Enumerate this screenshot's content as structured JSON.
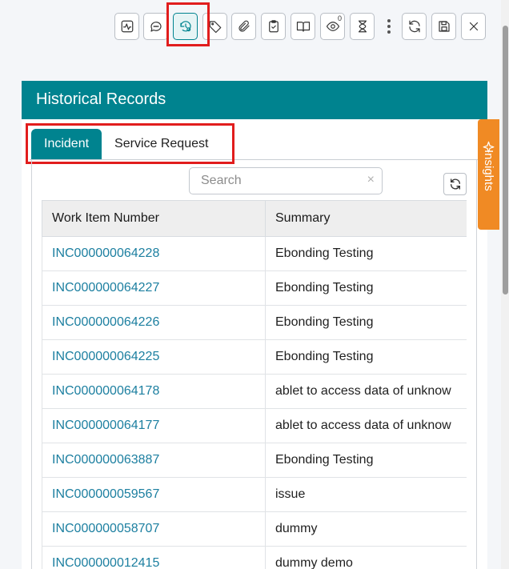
{
  "toolbar": {
    "buttons": [
      {
        "name": "activity-icon",
        "active": false
      },
      {
        "name": "chat-icon",
        "active": false
      },
      {
        "name": "history-settings-icon",
        "active": true
      },
      {
        "name": "tag-icon",
        "active": false
      },
      {
        "name": "paperclip-icon",
        "active": false
      },
      {
        "name": "clipboard-check-icon",
        "active": false
      },
      {
        "name": "book-open-icon",
        "active": false
      },
      {
        "name": "eye-icon",
        "active": false,
        "badge": "0"
      },
      {
        "name": "hourglass-icon",
        "active": false
      },
      {
        "name": "kebab-menu-icon",
        "active": false
      },
      {
        "name": "refresh-icon",
        "active": false
      },
      {
        "name": "save-icon",
        "active": false
      },
      {
        "name": "close-icon",
        "active": false
      }
    ]
  },
  "panel": {
    "title": "Historical Records"
  },
  "tabs": [
    {
      "label": "Incident",
      "active": true
    },
    {
      "label": "Service Request",
      "active": false
    }
  ],
  "search": {
    "placeholder": "Search",
    "value": "",
    "clear_icon": "×"
  },
  "table": {
    "columns": [
      "Work Item Number",
      "Summary"
    ],
    "rows": [
      {
        "number": "INC000000064228",
        "summary": "Ebonding Testing"
      },
      {
        "number": "INC000000064227",
        "summary": "Ebonding Testing"
      },
      {
        "number": "INC000000064226",
        "summary": "Ebonding Testing"
      },
      {
        "number": "INC000000064225",
        "summary": "Ebonding Testing"
      },
      {
        "number": "INC000000064178",
        "summary": "ablet to access data of unknow"
      },
      {
        "number": "INC000000064177",
        "summary": "ablet to access data of unknow"
      },
      {
        "number": "INC000000063887",
        "summary": "Ebonding Testing"
      },
      {
        "number": "INC000000059567",
        "summary": "issue"
      },
      {
        "number": "INC000000058707",
        "summary": "dummy"
      },
      {
        "number": "INC000000012415",
        "summary": "dummy demo"
      }
    ]
  },
  "insights": {
    "label": "Insights"
  },
  "colors": {
    "accent": "#00838f",
    "link": "#1c7fa0",
    "insights": "#f08a24",
    "highlight": "#e11d1d"
  }
}
